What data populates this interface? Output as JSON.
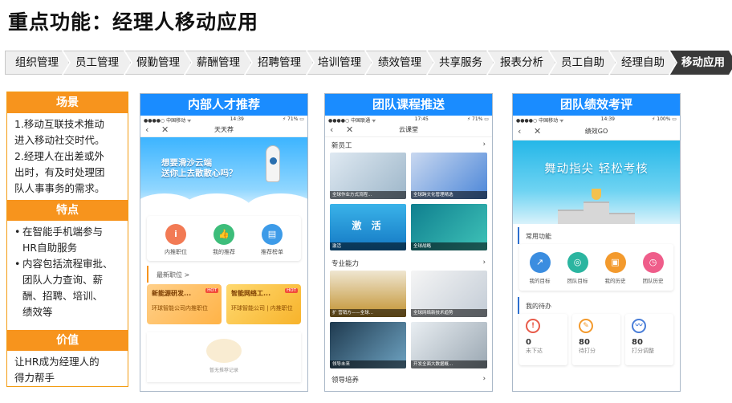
{
  "title": "重点功能：经理人移动应用",
  "steps": [
    "组织管理",
    "员工管理",
    "假勤管理",
    "薪酬管理",
    "招聘管理",
    "培训管理",
    "绩效管理",
    "共享服务",
    "报表分析",
    "员工自助",
    "经理自助",
    "移动应用"
  ],
  "panel": {
    "scene_header": "场景",
    "scene_lines": [
      "1.移动互联技术推动",
      "进入移动社交时代。",
      "2.经理人在出差或外",
      "出时，有及时处理团",
      "队人事事务的需求。"
    ],
    "feature_header": "特点",
    "feature_items": [
      [
        "在智能手机端参与",
        "HR自助服务"
      ],
      [
        "内容包括流程审批、",
        "团队人力查询、薪",
        "酬、招聘、培训、",
        "绩效等"
      ]
    ],
    "value_header": "价值",
    "value_lines": [
      "让HR成为经理人的",
      "得力帮手"
    ]
  },
  "phone1": {
    "caption": "内部人才推荐",
    "status_left": "●●●●○ 中国移动 ᯤ",
    "status_time": "14:39",
    "status_right": "⚡ 71% ▭",
    "nav_title": "天天荐",
    "back_icon": "‹",
    "close_icon": "✕",
    "banner_line1": "想要滑沙云端",
    "banner_line2": "送你上去散散心吗？",
    "icons": [
      {
        "glyph": "i",
        "label": "内推职位",
        "color": "#f27a54"
      },
      {
        "glyph": "👍",
        "label": "我的推荐",
        "color": "#3dbd7a"
      },
      {
        "glyph": "▤",
        "label": "推荐榜单",
        "color": "#3d9be8"
      }
    ],
    "section": "最新职位 >",
    "cards": [
      {
        "name": "新能源研发...",
        "sub": "环球智能公司内推职位",
        "hot": "HOT"
      },
      {
        "name": "智能网络工...",
        "sub": "环球智能公司 | 内推职位",
        "hot": "HOT"
      }
    ],
    "empty_label": "暂无推荐记录"
  },
  "phone2": {
    "caption": "团队课程推送",
    "status_left": "●●●●○ 中国联通 ᯤ",
    "status_time": "17:45",
    "status_right": "⚡ 71% ▭",
    "nav_title": "云课堂",
    "back_icon": "‹",
    "close_icon": "✕",
    "cat1": "新员工",
    "cat2": "专业能力",
    "cat3": "领导培养",
    "more": "›",
    "tiles1": [
      {
        "label": "全球作业方式流程...",
        "overlay": "",
        "bg": "linear-gradient(135deg,#dfe9f2,#9db6c9)"
      },
      {
        "label": "全球跨文化管理精选",
        "overlay": "",
        "bg": "linear-gradient(135deg,#c9d8f0,#4b86d8)"
      },
      {
        "label": "激活",
        "overlay": "激 活",
        "bg": "linear-gradient(180deg,#3ab3e9,#1478c4)"
      },
      {
        "label": "全球战略",
        "overlay": "",
        "bg": "linear-gradient(135deg,#0f7f8f,#3fc3b8)"
      }
    ],
    "tiles2": [
      {
        "label": "扩 营销方——全球...",
        "overlay": "",
        "bg": "linear-gradient(180deg,#efe6d1,#c2922f)"
      },
      {
        "label": "全球网络新技术趋势",
        "overlay": "",
        "bg": "linear-gradient(135deg,#f5f5f5,#c3ccd6)"
      },
      {
        "label": "领导未来",
        "overlay": "",
        "bg": "linear-gradient(135deg,#1f3a4f,#6ea3c2)"
      },
      {
        "label": "开发全面大数据概...",
        "overlay": "",
        "bg": "linear-gradient(135deg,#e9eef2,#9aa7b2)"
      }
    ]
  },
  "phone3": {
    "caption": "团队绩效考评",
    "status_left": "●●●●○ 中国移动 ᯤ",
    "status_time": "14:39",
    "status_right": "⚡ 100% ▭",
    "nav_title": "绩效GO",
    "back_icon": "‹",
    "close_icon": "✕",
    "banner_text": "舞动指尖  轻松考核",
    "section1": "常用功能",
    "section2": "我的待办",
    "functions": [
      {
        "glyph": "↗",
        "label": "我的目标",
        "color": "#3b8de0"
      },
      {
        "glyph": "◎",
        "label": "团队目标",
        "color": "#2bb5a0"
      },
      {
        "glyph": "▣",
        "label": "我的历史",
        "color": "#f39a2d"
      },
      {
        "glyph": "◷",
        "label": "团队历史",
        "color": "#ef5d8a"
      }
    ],
    "todos": [
      {
        "glyph": "!",
        "num": "0",
        "label": "未下达",
        "color": "#e85b4a"
      },
      {
        "glyph": "✎",
        "num": "80",
        "label": "待打分",
        "color": "#f39a2d"
      },
      {
        "glyph": "〰",
        "num": "80",
        "label": "打分调整",
        "color": "#4a7ed8"
      }
    ]
  }
}
